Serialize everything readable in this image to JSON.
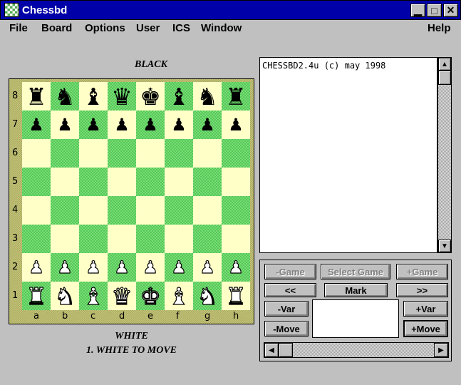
{
  "window": {
    "title": "Chessbd"
  },
  "titlebar_buttons": {
    "minimize": "▁",
    "maximize": "□",
    "close": "✕"
  },
  "menu": [
    "File",
    "Board",
    "Options",
    "User",
    "ICS",
    "Window"
  ],
  "menu_help": "Help",
  "board": {
    "top_label": "BLACK",
    "bottom_label": "WHITE",
    "status": "1. WHITE TO MOVE",
    "files": [
      "a",
      "b",
      "c",
      "d",
      "e",
      "f",
      "g",
      "h"
    ],
    "ranks": [
      "8",
      "7",
      "6",
      "5",
      "4",
      "3",
      "2",
      "1"
    ],
    "position": [
      [
        "br",
        "bn",
        "bb",
        "bq",
        "bk",
        "bb",
        "bn",
        "br"
      ],
      [
        "bp",
        "bp",
        "bp",
        "bp",
        "bp",
        "bp",
        "bp",
        "bp"
      ],
      [
        "",
        "",
        "",
        "",
        "",
        "",
        "",
        ""
      ],
      [
        "",
        "",
        "",
        "",
        "",
        "",
        "",
        ""
      ],
      [
        "",
        "",
        "",
        "",
        "",
        "",
        "",
        ""
      ],
      [
        "",
        "",
        "",
        "",
        "",
        "",
        "",
        ""
      ],
      [
        "wp",
        "wp",
        "wp",
        "wp",
        "wp",
        "wp",
        "wp",
        "wp"
      ],
      [
        "wr",
        "wn",
        "wb",
        "wq",
        "wk",
        "wb",
        "wn",
        "wr"
      ]
    ]
  },
  "text_panel": {
    "line": "CHESSBD2.4u (c) may 1998"
  },
  "buttons": {
    "prev_game": "-Game",
    "select_game": "Select Game",
    "next_game": "+Game",
    "back_all": "<<",
    "mark": "Mark",
    "forward_all": ">>",
    "prev_var": "-Var",
    "next_var": "+Var",
    "prev_move": "-Move",
    "next_move": "+Move"
  },
  "scroll_arrows": {
    "up": "▲",
    "down": "▼",
    "left": "◀",
    "right": "▶"
  }
}
